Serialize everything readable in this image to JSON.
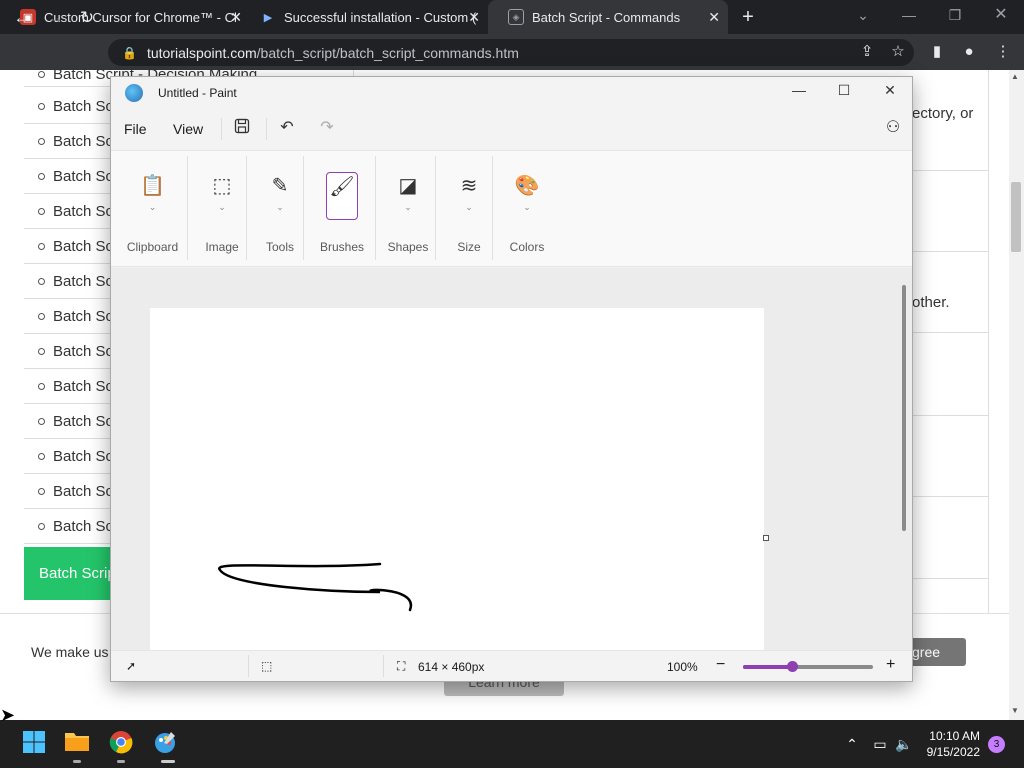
{
  "chrome": {
    "tabs": [
      {
        "title": "Custom Cursor for Chrome™ - Cl",
        "favicon": "custom-cursor-favicon"
      },
      {
        "title": "Successful installation - Custom (",
        "favicon": "cursor-arrow-favicon"
      },
      {
        "title": "Batch Script - Commands",
        "favicon": "tutorialspoint-favicon"
      }
    ],
    "new_tab": "+",
    "address": {
      "host": "tutorialspoint.com",
      "path": "/batch_script/batch_script_commands.htm"
    }
  },
  "webpage": {
    "sidebar_top_item": "Batch Script - Decision Making",
    "sidebar_items": [
      "Batch Sc",
      "Batch Sc",
      "Batch Sc",
      "Batch Sc",
      "Batch Sc",
      "Batch Sc",
      "Batch Sc",
      "Batch Sc",
      "Batch Sc",
      "Batch Sc",
      "Batch Sc",
      "Batch Sc",
      "Batch Sc"
    ],
    "green_button": "Batch Scrip",
    "right_text_1": "ectory,  or",
    "right_text_2": "other.",
    "cookie_text": "We make us",
    "agree_button": "gree",
    "learn_more_button": "Learn more"
  },
  "paint": {
    "title": "Untitled - Paint",
    "menu": {
      "file": "File",
      "view": "View"
    },
    "ribbon_groups": [
      {
        "label": "Clipboard",
        "icon": "clipboard-icon"
      },
      {
        "label": "Image",
        "icon": "selection-icon"
      },
      {
        "label": "Tools",
        "icon": "tools-icon"
      },
      {
        "label": "Brushes",
        "icon": "brush-icon"
      },
      {
        "label": "Shapes",
        "icon": "shapes-icon"
      },
      {
        "label": "Size",
        "icon": "size-icon"
      },
      {
        "label": "Colors",
        "icon": "palette-icon"
      }
    ],
    "status": {
      "canvas_size": "614 × 460px",
      "zoom": "100%",
      "zoom_level": 0.38
    },
    "accent": "#8e3fb0"
  },
  "taskbar": {
    "time": "10:10 AM",
    "date": "9/15/2022",
    "notifications": "3",
    "apps": [
      "windows-start-icon",
      "file-explorer-icon",
      "chrome-icon",
      "paint-icon"
    ]
  }
}
